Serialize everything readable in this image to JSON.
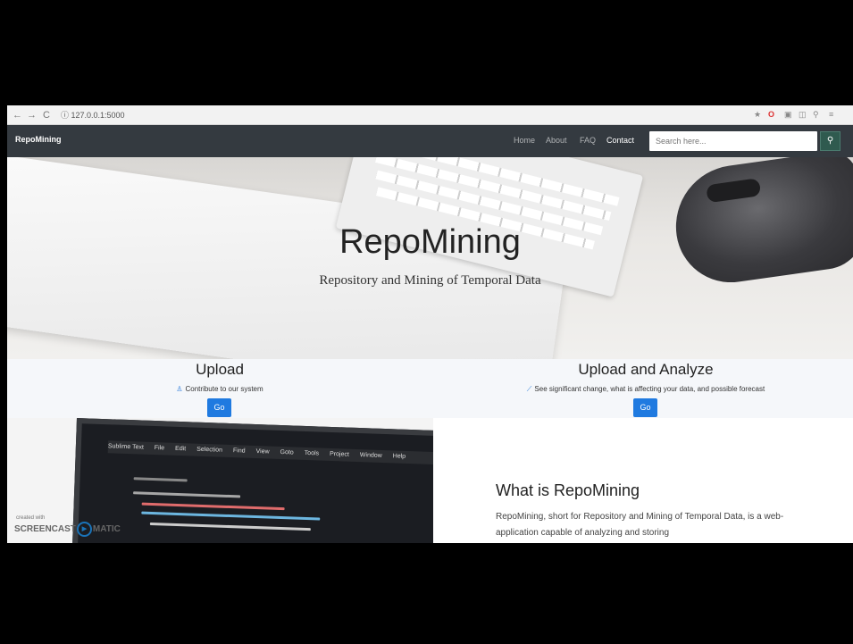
{
  "browser": {
    "back": "←",
    "forward": "→",
    "reload": "C",
    "address": "ⓘ 127.0.0.1:5000"
  },
  "navbar": {
    "brand": "RepoMining",
    "links": [
      "Home",
      "About",
      "FAQ",
      "Contact"
    ],
    "search_placeholder": "Search here...",
    "search_icon": "search-icon"
  },
  "hero": {
    "title": "RepoMining",
    "subtitle": "Repository and Mining of Temporal Data"
  },
  "features": [
    {
      "title": "Upload",
      "icon": "user-upload-icon",
      "description": "Contribute to our system",
      "button": "Go"
    },
    {
      "title": "Upload and Analyze",
      "icon": "chart-line-icon",
      "description": "See significant change, what is affecting your data, and possible forecast",
      "button": "Go"
    }
  ],
  "laptop": {
    "menu": [
      "Sublime Text",
      "File",
      "Edit",
      "Selection",
      "Find",
      "View",
      "Goto",
      "Tools",
      "Project",
      "Window",
      "Help"
    ]
  },
  "about": {
    "title": "What is RepoMining",
    "text": "RepoMining, short for Repository and Mining of Temporal Data, is a web-application capable of analyzing and storing"
  },
  "watermark": {
    "small": "created with",
    "brand": "SCREENCAST",
    "suffix": "MATIC"
  },
  "colors": {
    "navbar": "#343a40",
    "accent": "#1f7ae0",
    "search_button": "#2f5a4f"
  }
}
